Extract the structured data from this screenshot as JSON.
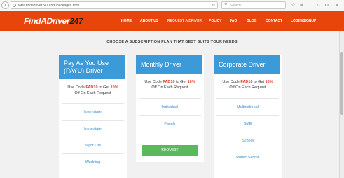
{
  "browser": {
    "url": "www.findadriver247.com/packages.html",
    "search_placeholder": "Search",
    "back_icon": "back-arrow-icon",
    "reload_icon": "reload-icon"
  },
  "site": {
    "logo_main": "FindADriver",
    "logo_accent": "247",
    "brand_color": "#e8450c",
    "accent_color": "#3d9ad8"
  },
  "nav": {
    "items": [
      {
        "label": "HOME"
      },
      {
        "label": "ABOUT US"
      },
      {
        "label": "REQUEST A DRIVER"
      },
      {
        "label": "POLICY"
      },
      {
        "label": "FAQ"
      },
      {
        "label": "BLOG"
      },
      {
        "label": "CONTACT"
      },
      {
        "label": "LOGIN/SIGNUP"
      }
    ],
    "active_index": 2
  },
  "main": {
    "heading": "CHOOSE A SUBSCRIPTION PLAN THAT BEST SUITS YOUR NEEDS",
    "plans": [
      {
        "title": "Pay As You Use (PAYU) Driver",
        "promo_prefix": "Use Code",
        "promo_code": "FAD10",
        "promo_mid": "to Get",
        "promo_discount": "10%",
        "promo_suffix": "Off On Each Request",
        "options": [
          "Inter-state",
          "Intra-state",
          "Night Life",
          "Wedding"
        ]
      },
      {
        "title": "Monthly Driver",
        "promo_prefix": "Use Code",
        "promo_code": "FAD10",
        "promo_mid": "to Get",
        "promo_discount": "10%",
        "promo_suffix": "Off On Each Request",
        "options": [
          "Individual",
          "Family"
        ],
        "button_label": "REQUEST"
      },
      {
        "title": "Corporate Driver",
        "promo_prefix": "Use Code",
        "promo_code": "FAD10",
        "promo_mid": "to Get",
        "promo_discount": "10%",
        "promo_suffix": "Off On Each Request",
        "options": [
          "Multinational",
          "SME",
          "School",
          "Public Sector"
        ]
      }
    ]
  }
}
